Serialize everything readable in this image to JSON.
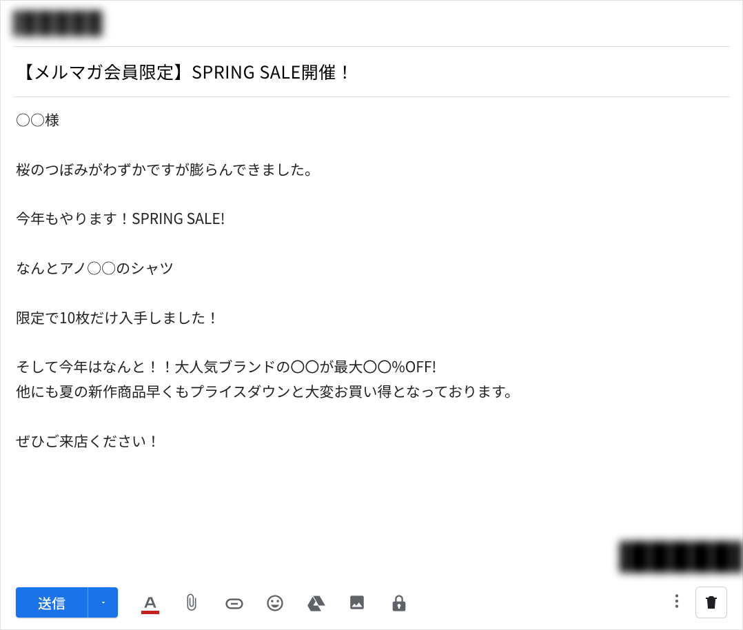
{
  "subject": "【メルマガ会員限定】SPRING SALE開催！",
  "body": {
    "p1": "○○様",
    "p2": "桜のつぼみがわずかですが膨らんできました。",
    "p3": "今年もやります！SPRING SALE!",
    "p4": "なんとアノ○○のシャツ",
    "p5": "限定で10枚だけ入手しました！",
    "p6a": "そして今年はなんと！！大人気ブランドの〇〇が最大〇〇%OFF!",
    "p6b": "他にも夏の新作商品早くもプライスダウンと大変お買い得となっております。",
    "p7": "ぜひご来店ください！"
  },
  "toolbar": {
    "send_label": "送信"
  }
}
